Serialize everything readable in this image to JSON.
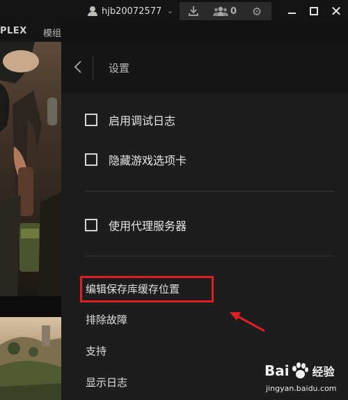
{
  "titlebar": {
    "username": "hjb20072577",
    "friends_count": "0"
  },
  "nav": {
    "item_a": "PLEX",
    "item_b": "模组"
  },
  "settings": {
    "title": "设置",
    "checkboxes": [
      {
        "label": "启用调试日志",
        "checked": false
      },
      {
        "label": "隐藏游戏选项卡",
        "checked": false
      },
      {
        "label": "使用代理服务器",
        "checked": false
      }
    ],
    "links": [
      "编辑保存库缓存位置",
      "排除故障",
      "支持",
      "显示日志"
    ]
  },
  "watermark": {
    "brand_left": "Bai",
    "brand_right": "经验",
    "url": "jingyan.baidu.com"
  },
  "colors": {
    "status_online": "#76b900",
    "highlight": "#e01e24",
    "panel_bg": "#1d1d1d"
  },
  "icons": [
    "user-icon",
    "download-icon",
    "friends-icon",
    "gear-icon",
    "back-chevron-icon",
    "minimize-icon",
    "maximize-icon",
    "close-icon"
  ]
}
